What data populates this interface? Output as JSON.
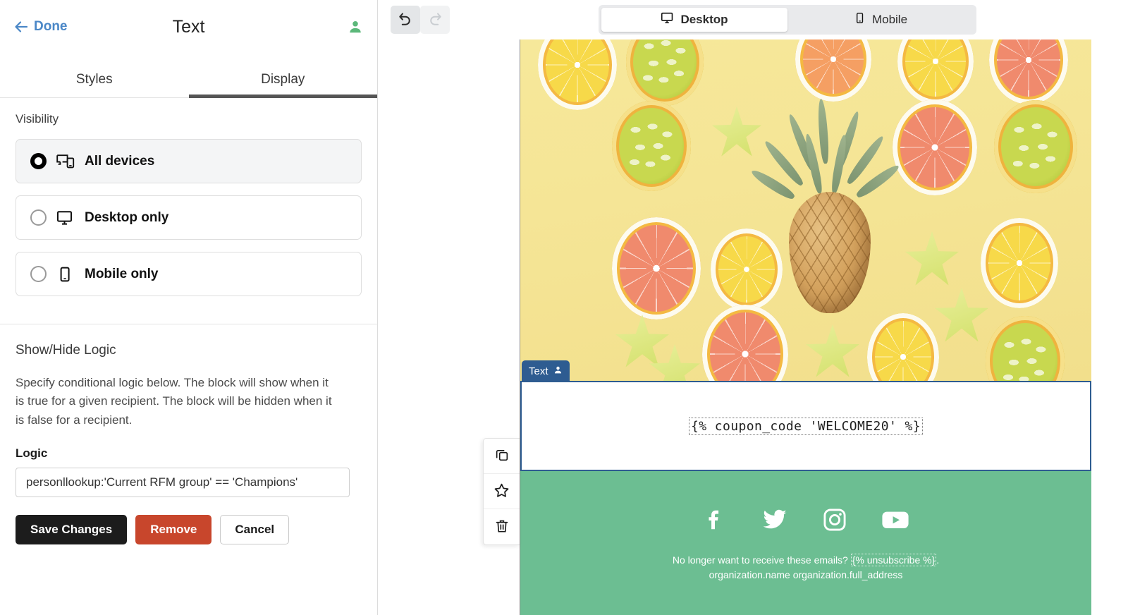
{
  "left_panel": {
    "header": {
      "done_label": "Done",
      "title": "Text",
      "back_icon": "back-arrow-icon",
      "person_icon": "person-icon"
    },
    "tabs": [
      {
        "label": "Styles",
        "active": false
      },
      {
        "label": "Display",
        "active": true
      }
    ],
    "visibility": {
      "section_label": "Visibility",
      "options": [
        {
          "label": "All devices",
          "icon": "desktop-mobile-icon",
          "selected": true
        },
        {
          "label": "Desktop only",
          "icon": "desktop-icon",
          "selected": false
        },
        {
          "label": "Mobile only",
          "icon": "mobile-icon",
          "selected": false
        }
      ]
    },
    "logic": {
      "title": "Show/Hide Logic",
      "description": "Specify conditional logic below. The block will show when it is true for a given recipient. The block will be hidden when it is false for a recipient.",
      "field_label": "Logic",
      "field_value": "personllookup:'Current RFM group' == 'Champions'",
      "field_placeholder": "Enter logic",
      "buttons": {
        "save": "Save Changes",
        "remove": "Remove",
        "cancel": "Cancel"
      }
    }
  },
  "toolbar": {
    "undo_icon": "undo-icon",
    "redo_icon": "redo-icon",
    "undo_enabled": true,
    "redo_enabled": false,
    "preview_modes": [
      {
        "label": "Desktop",
        "icon": "desktop-icon",
        "active": true
      },
      {
        "label": "Mobile",
        "icon": "mobile-icon",
        "active": false
      }
    ]
  },
  "canvas": {
    "hero_image_alt": "citrus-fruit-flatlay-image",
    "selected_block": {
      "tag_label": "Text",
      "tag_icon": "person-icon",
      "content": "{% coupon_code 'WELCOME20' %}"
    },
    "block_tools": [
      {
        "icon": "duplicate-icon",
        "name": "duplicate-block-button"
      },
      {
        "icon": "star-icon",
        "name": "favorite-block-button"
      },
      {
        "icon": "trash-icon",
        "name": "delete-block-button"
      }
    ],
    "footer": {
      "social": [
        {
          "name": "facebook-icon"
        },
        {
          "name": "twitter-icon"
        },
        {
          "name": "instagram-icon"
        },
        {
          "name": "youtube-icon"
        }
      ],
      "unsubscribe_prefix": "No longer want to receive these emails? ",
      "unsubscribe_tag": "{% unsubscribe %}",
      "unsubscribe_suffix": ".",
      "org_line": "organization.name organization.full_address"
    }
  },
  "colors": {
    "accent_blue": "#4a87c7",
    "block_border_blue": "#2e5c91",
    "danger_red": "#c8462c",
    "footer_green": "#6cbe92",
    "hero_yellow": "#f5e596",
    "person_green": "#5cb87a"
  }
}
